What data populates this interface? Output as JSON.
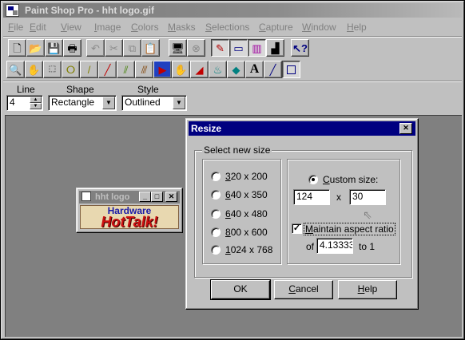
{
  "app": {
    "title": "Paint Shop Pro - hht logo.gif",
    "icon": "paint-shop-pro-app-icon"
  },
  "menu": [
    "File",
    "Edit",
    "View",
    "Image",
    "Colors",
    "Masks",
    "Selections",
    "Capture",
    "Window",
    "Help"
  ],
  "toolbar1": [
    "new-file-icon",
    "open-folder-icon",
    "save-disk-icon",
    "print-icon",
    "undo-icon",
    "cut-scissors-icon",
    "copy-icon",
    "paste-icon",
    "full-screen-icon",
    "stop-icon",
    "color-palette-icon",
    "toolbar-toggle-icon",
    "histogram-icon",
    "context-help-icon"
  ],
  "toolbar2": [
    "zoom-icon",
    "hand-pan-icon",
    "selection-rect-icon",
    "lasso-icon",
    "dropper-icon",
    "paintbrush-icon",
    "clone-brush-icon",
    "color-replacer-icon",
    "retouch-icon",
    "eraser-icon",
    "flood-fill-icon",
    "gradient-icon",
    "text-icon",
    "line-icon",
    "shape-icon"
  ],
  "style_bar": {
    "line_label": "Line",
    "line_value": "4",
    "shape_label": "Shape",
    "shape_value": "Rectangle",
    "style_label": "Style",
    "style_value": "Outlined"
  },
  "image_window": {
    "title": "hht logo",
    "logo_line1": "Hardware",
    "logo_line2": "HotTalk!",
    "logo_colors": {
      "line1": "#1a1aa8",
      "line2": "#cc1010",
      "bg": "#e8d8b0"
    }
  },
  "dialog": {
    "title": "Resize",
    "group_label": "Select new size",
    "presets": [
      "320 x 200",
      "640 x 350",
      "640 x 480",
      "800 x 600",
      "1024 x 768"
    ],
    "custom_label": "Custom size:",
    "width": "124",
    "times": "x",
    "height": "30",
    "aspect_label": "Maintain aspect ratio",
    "aspect_checked": true,
    "of_label": "of",
    "ratio": "4.13333",
    "to_label": "to 1",
    "ok": "OK",
    "cancel": "Cancel",
    "help": "Help"
  }
}
